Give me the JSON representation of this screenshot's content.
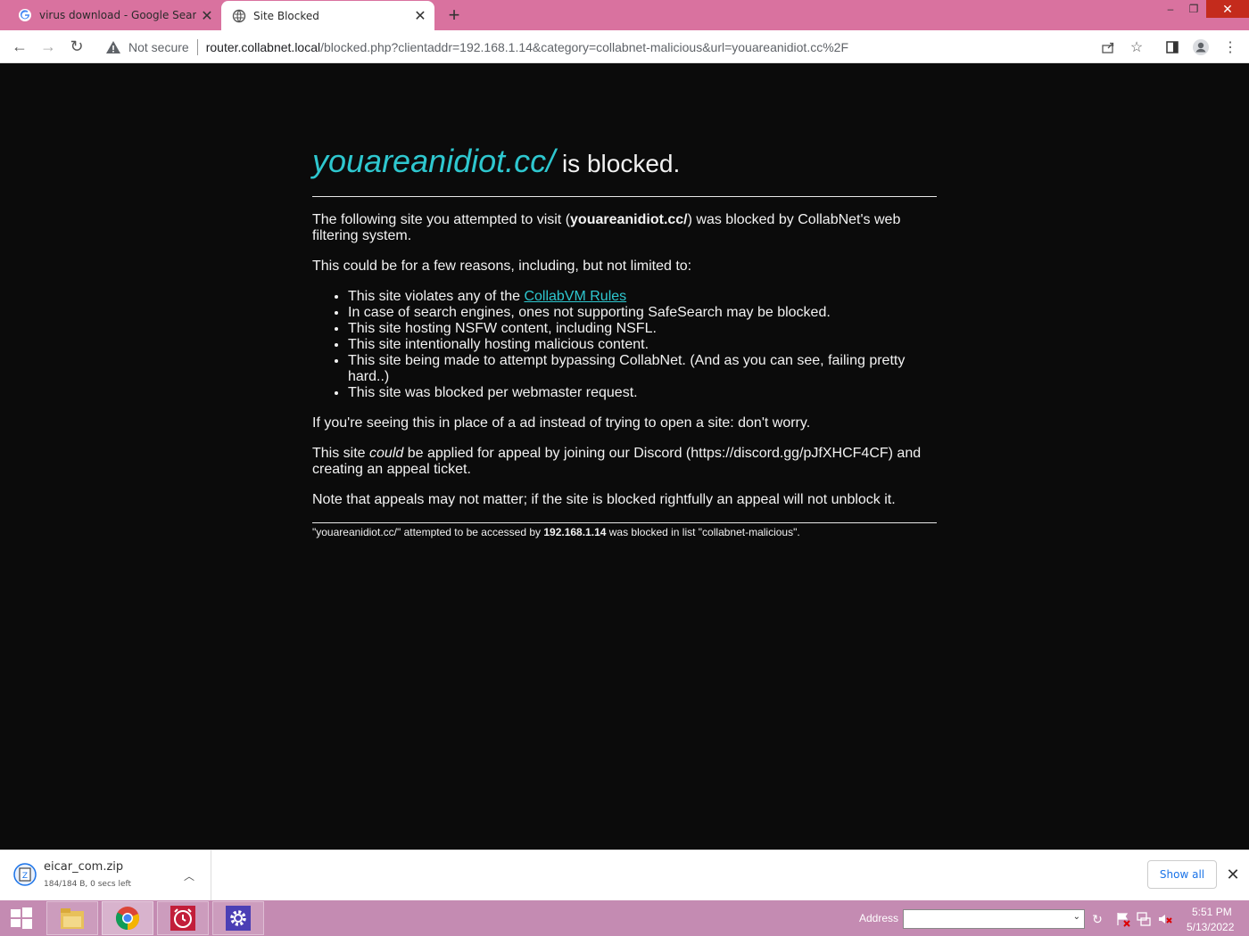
{
  "browser": {
    "tabs": [
      {
        "title": "virus download - Google Search",
        "icon": "google-icon",
        "active": false
      },
      {
        "title": "Site Blocked",
        "icon": "globe-icon",
        "active": true
      }
    ],
    "new_tab_label": "+",
    "address": {
      "security_label": "Not secure",
      "url_host": "router.collabnet.local",
      "url_rest": "/blocked.php?clientaddr=192.168.1.14&category=collabnet-malicious&url=youareanidiot.cc%2F"
    }
  },
  "page": {
    "heading_site": "youareanidiot.cc/",
    "heading_suffix": " is blocked.",
    "intro_prefix": "The following site you attempted to visit (",
    "intro_site": "youareanidiot.cc/",
    "intro_suffix": ") was blocked by CollabNet's web filtering system.",
    "reasons_intro": "This could be for a few reasons, including, but not limited to:",
    "rules_prefix": "This site violates any of the ",
    "rules_link": "CollabVM Rules",
    "reasons": [
      "In case of search engines, ones not supporting SafeSearch may be blocked.",
      "This site hosting NSFW content, including NSFL.",
      "This site intentionally hosting malicious content.",
      "This site being made to attempt bypassing CollabNet. (And as you can see, failing pretty hard..)",
      "This site was blocked per webmaster request."
    ],
    "ad_note": "If you're seeing this in place of a ad instead of trying to open a site: don't worry.",
    "appeal_prefix": "This site ",
    "appeal_emph": "could",
    "appeal_suffix": " be applied for appeal by joining our Discord (https://discord.gg/pJfXHCF4CF) and creating an appeal ticket.",
    "appeal_note": "Note that appeals may not matter; if the site is blocked rightfully an appeal will not unblock it.",
    "footer_prefix": "\"youareanidiot.cc/\" attempted to be accessed by ",
    "footer_ip": "192.168.1.14",
    "footer_suffix": " was blocked in list \"collabnet-malicious\"."
  },
  "downloads": {
    "file_name": "eicar_com.zip",
    "status": "184/184 B, 0 secs left",
    "show_all_label": "Show all"
  },
  "taskbar": {
    "address_label": "Address",
    "address_value": "",
    "time": "5:51 PM",
    "date": "5/13/2022"
  },
  "colors": {
    "accent_link": "#2ec7cf",
    "tabstrip": "#d9729f",
    "page_bg": "#0b0b0b",
    "taskbar": "#c48bb2"
  }
}
